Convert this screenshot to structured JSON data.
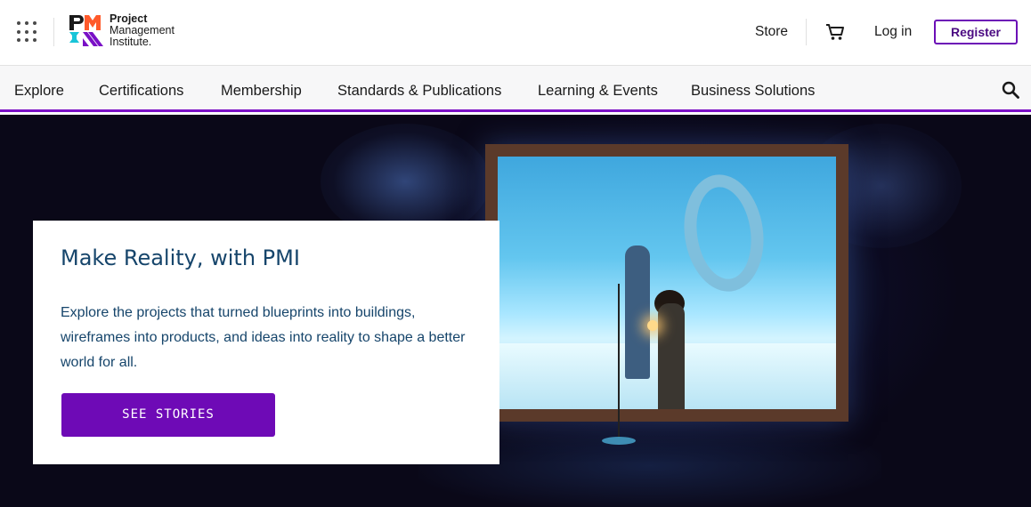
{
  "header": {
    "logo": {
      "line1": "Project",
      "line2": "Management",
      "line3": "Institute."
    },
    "store_label": "Store",
    "cart_icon": "cart-icon",
    "login_label": "Log in",
    "register_label": "Register",
    "apps_icon": "grid-menu-icon"
  },
  "nav": {
    "items": [
      {
        "label": "Explore"
      },
      {
        "label": "Certifications"
      },
      {
        "label": "Membership"
      },
      {
        "label": "Standards & Publications"
      },
      {
        "label": "Learning & Events"
      },
      {
        "label": "Business Solutions"
      }
    ],
    "search_icon": "search-icon"
  },
  "hero": {
    "title": "Make Reality, with PMI",
    "body": "Explore the projects that turned blueprints into buildings, wireframes into products, and ideas into reality to shape a better world for all.",
    "cta_label": "SEE STORIES"
  },
  "colors": {
    "accent": "#6e0ab6",
    "title_blue": "#16456b",
    "nav_underline": "#7a10c6"
  }
}
